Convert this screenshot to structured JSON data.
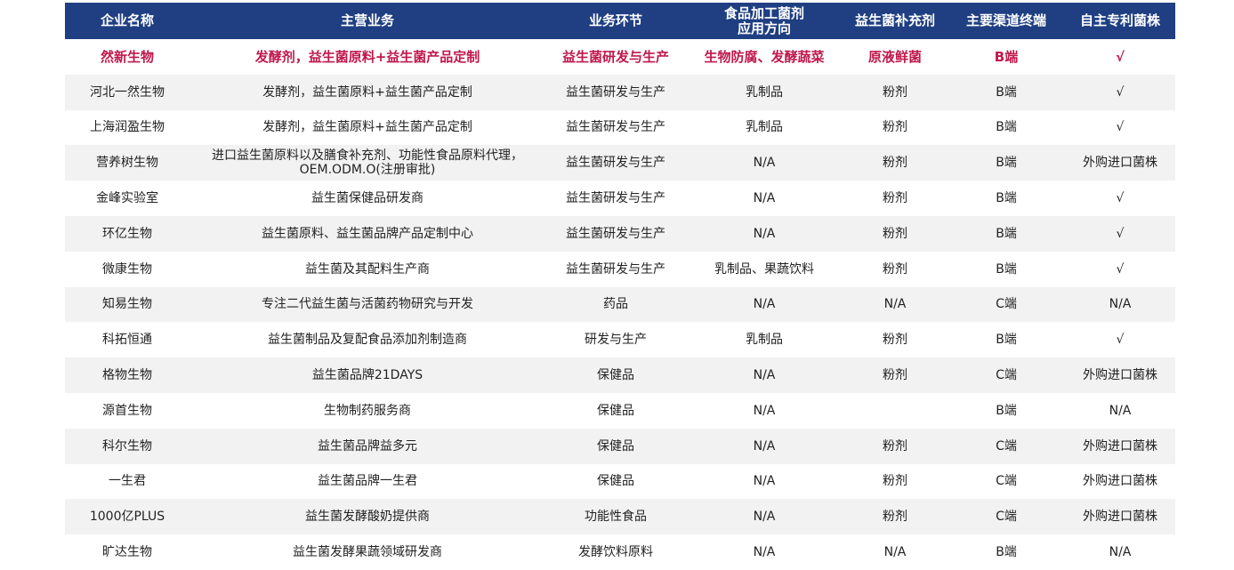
{
  "table": {
    "headers": [
      [
        "企业名称"
      ],
      [
        "主营业务"
      ],
      [
        "业务环节"
      ],
      [
        "食品加工菌剂",
        "应用方向"
      ],
      [
        "益生菌补充剂"
      ],
      [
        "主要渠道终端"
      ],
      [
        "自主专利菌株"
      ]
    ],
    "rows": [
      [
        "然新生物",
        "发酵剂，益生菌原料+益生菌产品定制",
        "益生菌研发与生产",
        "生物防腐、发酵蔬菜",
        "原液鲜菌",
        "B端",
        "√"
      ],
      [
        "河北一然生物",
        "发酵剂，益生菌原料+益生菌产品定制",
        "益生菌研发与生产",
        "乳制品",
        "粉剂",
        "B端",
        "√"
      ],
      [
        "上海润盈生物",
        "发酵剂，益生菌原料+益生菌产品定制",
        "益生菌研发与生产",
        "乳制品",
        "粉剂",
        "B端",
        "√"
      ],
      [
        "营养树生物",
        "进口益生菌原料以及膳食补充剂、功能性食品原料代理，OEM.ODM.O(注册审批)",
        "益生菌研发与生产",
        "N/A",
        "粉剂",
        "B端",
        "外购进口菌株"
      ],
      [
        "金峰实验室",
        "益生菌保健品研发商",
        "益生菌研发与生产",
        "N/A",
        "粉剂",
        "B端",
        "√"
      ],
      [
        "环亿生物",
        "益生菌原料、益生菌品牌产品定制中心",
        "益生菌研发与生产",
        "N/A",
        "粉剂",
        "B端",
        "√"
      ],
      [
        "微康生物",
        "益生菌及其配料生产商",
        "益生菌研发与生产",
        "乳制品、果蔬饮料",
        "粉剂",
        "B端",
        "√"
      ],
      [
        "知易生物",
        "专注二代益生菌与活菌药物研究与开发",
        "药品",
        "N/A",
        "N/A",
        "C端",
        "N/A"
      ],
      [
        "科拓恒通",
        "益生菌制品及复配食品添加剂制造商",
        "研发与生产",
        "乳制品",
        "粉剂",
        "B端",
        "√"
      ],
      [
        "格物生物",
        "益生菌品牌21DAYS",
        "保健品",
        "N/A",
        "粉剂",
        "C端",
        "外购进口菌株"
      ],
      [
        "源首生物",
        "生物制药服务商",
        "保健品",
        "N/A",
        "",
        "B端",
        "N/A"
      ],
      [
        "科尔生物",
        "益生菌品牌益多元",
        "保健品",
        "N/A",
        "粉剂",
        "C端",
        "外购进口菌株"
      ],
      [
        "一生君",
        "益生菌品牌一生君",
        "保健品",
        "N/A",
        "粉剂",
        "C端",
        "外购进口菌株"
      ],
      [
        "1000亿PLUS",
        "益生菌发酵酸奶提供商",
        "功能性食品",
        "N/A",
        "粉剂",
        "C端",
        "外购进口菌株"
      ],
      [
        "旷达生物",
        "益生菌发酵果蔬领域研发商",
        "发酵饮料原料",
        "N/A",
        "N/A",
        "B端",
        "N/A"
      ]
    ],
    "highlight_row": 0,
    "colors": {
      "header_bg": "#1f3f82",
      "header_text": "#ffffff",
      "highlight_text": "#c0184c",
      "stripe": "#f2f2f2"
    }
  }
}
